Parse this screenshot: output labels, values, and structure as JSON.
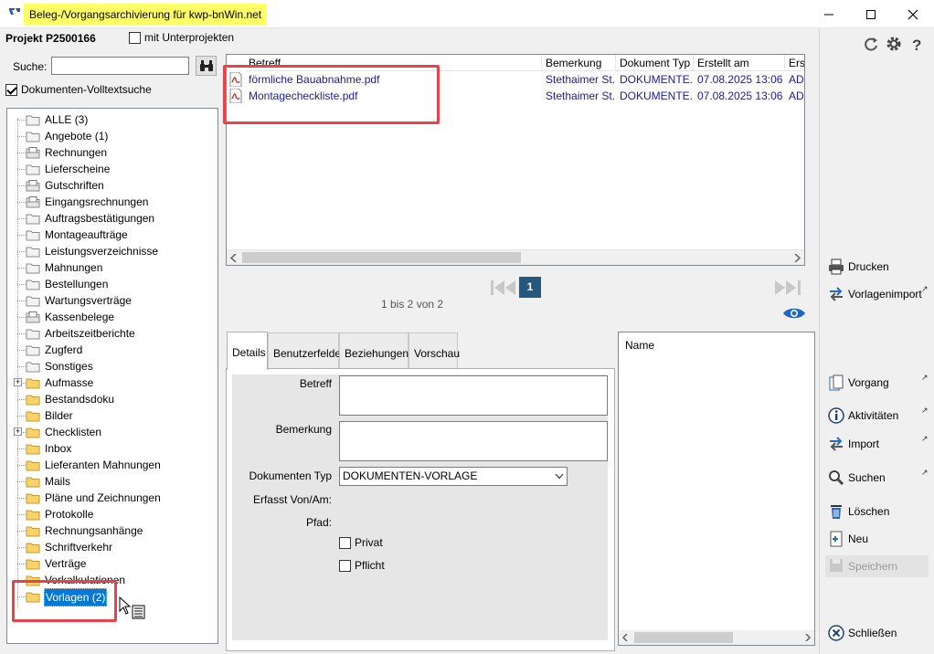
{
  "window": {
    "title": "Beleg-/Vorgangsarchivierung für kwp-bnWin.net"
  },
  "left": {
    "project_title": "Projekt P2500166",
    "sub_projects_label": "mit Unterprojekten",
    "search_label": "Suche:",
    "search_value": "",
    "fulltext_label": "Dokumenten-Volltextsuche",
    "tree": [
      {
        "label": "ALLE (3)"
      },
      {
        "label": "Angebote (1)"
      },
      {
        "label": "Rechnungen"
      },
      {
        "label": "Lieferscheine"
      },
      {
        "label": "Gutschriften"
      },
      {
        "label": "Eingangsrechnungen"
      },
      {
        "label": "Auftragsbestätigungen"
      },
      {
        "label": "Montageaufträge"
      },
      {
        "label": "Leistungsverzeichnisse"
      },
      {
        "label": "Mahnungen"
      },
      {
        "label": "Bestellungen"
      },
      {
        "label": "Wartungsverträge"
      },
      {
        "label": "Kassenbelege"
      },
      {
        "label": "Arbeitszeitberichte"
      },
      {
        "label": "Zugferd"
      },
      {
        "label": "Sonstiges"
      },
      {
        "label": "Aufmasse"
      },
      {
        "label": "Bestandsdoku"
      },
      {
        "label": "Bilder"
      },
      {
        "label": "Checklisten"
      },
      {
        "label": "Inbox"
      },
      {
        "label": "Lieferanten Mahnungen"
      },
      {
        "label": "Mails"
      },
      {
        "label": "Pläne und Zeichnungen"
      },
      {
        "label": "Protokolle"
      },
      {
        "label": "Rechnungsanhänge"
      },
      {
        "label": "Schriftverkehr"
      },
      {
        "label": "Verträge"
      },
      {
        "label": "Vorkalkulationen"
      },
      {
        "label": "Vorlagen (2)"
      }
    ]
  },
  "list": {
    "columns": [
      "Betreff",
      "Bemerkung",
      "Dokument Typ",
      "Erstellt am",
      "Erst"
    ],
    "rows": [
      {
        "betreff": "förmliche Bauabnahme.pdf",
        "bemerkung": "Stethaimer St...",
        "typ": "DOKUMENTE...",
        "erstellt": "07.08.2025 13:06",
        "erst": "ADM"
      },
      {
        "betreff": "Montagecheckliste.pdf",
        "bemerkung": "Stethaimer St...",
        "typ": "DOKUMENTE...",
        "erstellt": "07.08.2025 13:06",
        "erst": "ADM"
      }
    ]
  },
  "pager": {
    "current_page": "1",
    "range_text": "1 bis 2 von 2"
  },
  "tabs": [
    "Details",
    "Benutzerfelder",
    "Beziehungen",
    "Vorschau"
  ],
  "details": {
    "betreff_label": "Betreff",
    "bemerkung_label": "Bemerkung",
    "doktyp_label": "Dokumenten Typ",
    "doktyp_value": "DOKUMENTEN-VORLAGE",
    "erfasst_label": "Erfasst Von/Am:",
    "pfad_label": "Pfad:",
    "privat_label": "Privat",
    "pflicht_label": "Pflicht"
  },
  "name_panel": {
    "header": "Name"
  },
  "actions": {
    "drucken": "Drucken",
    "vorlagenimport": "Vorlagenimport",
    "vorgang": "Vorgang",
    "aktivitaeten": "Aktivitäten",
    "import": "Import",
    "suchen": "Suchen",
    "loeschen": "Löschen",
    "neu": "Neu",
    "speichern": "Speichern",
    "schliessen": "Schließen"
  },
  "colors": {
    "accent": "#0078d7",
    "highlight_title": "#ffff66",
    "annotation_red": "#e8434b",
    "link_blue": "#1a1aa6",
    "pager_blue": "#24587e"
  }
}
